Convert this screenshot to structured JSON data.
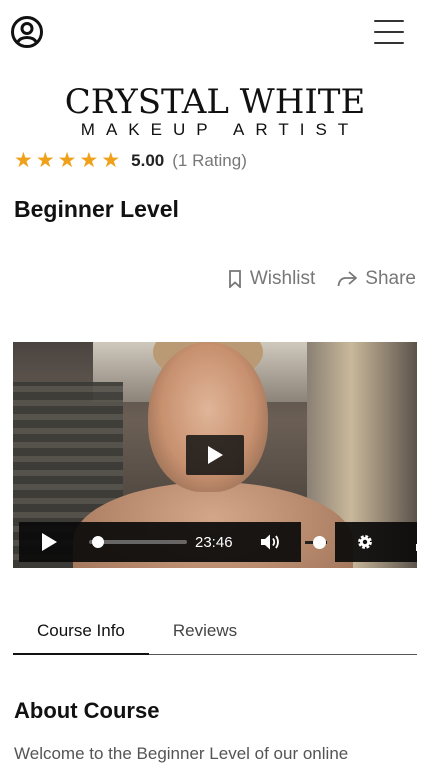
{
  "header": {
    "logo_title": "CRYSTAL WHITE",
    "logo_subtitle": "MAKEUP ARTIST",
    "account_icon": "user-circle-icon",
    "menu_icon": "hamburger-menu-icon"
  },
  "course": {
    "rating_value": "5.00",
    "rating_count": "(1 Rating)",
    "stars": 5,
    "title": "Beginner Level"
  },
  "actions": {
    "wishlist_label": "Wishlist",
    "share_label": "Share"
  },
  "video": {
    "time": "23:46",
    "progress": 0.0,
    "volume": 1.0
  },
  "tabs": [
    {
      "label": "Course Info",
      "active": true
    },
    {
      "label": "Reviews",
      "active": false
    }
  ],
  "about": {
    "title": "About Course",
    "text": "Welcome to the Beginner Level of our online"
  },
  "colors": {
    "star": "#f0a11a",
    "text": "#111111",
    "muted": "#777777"
  }
}
